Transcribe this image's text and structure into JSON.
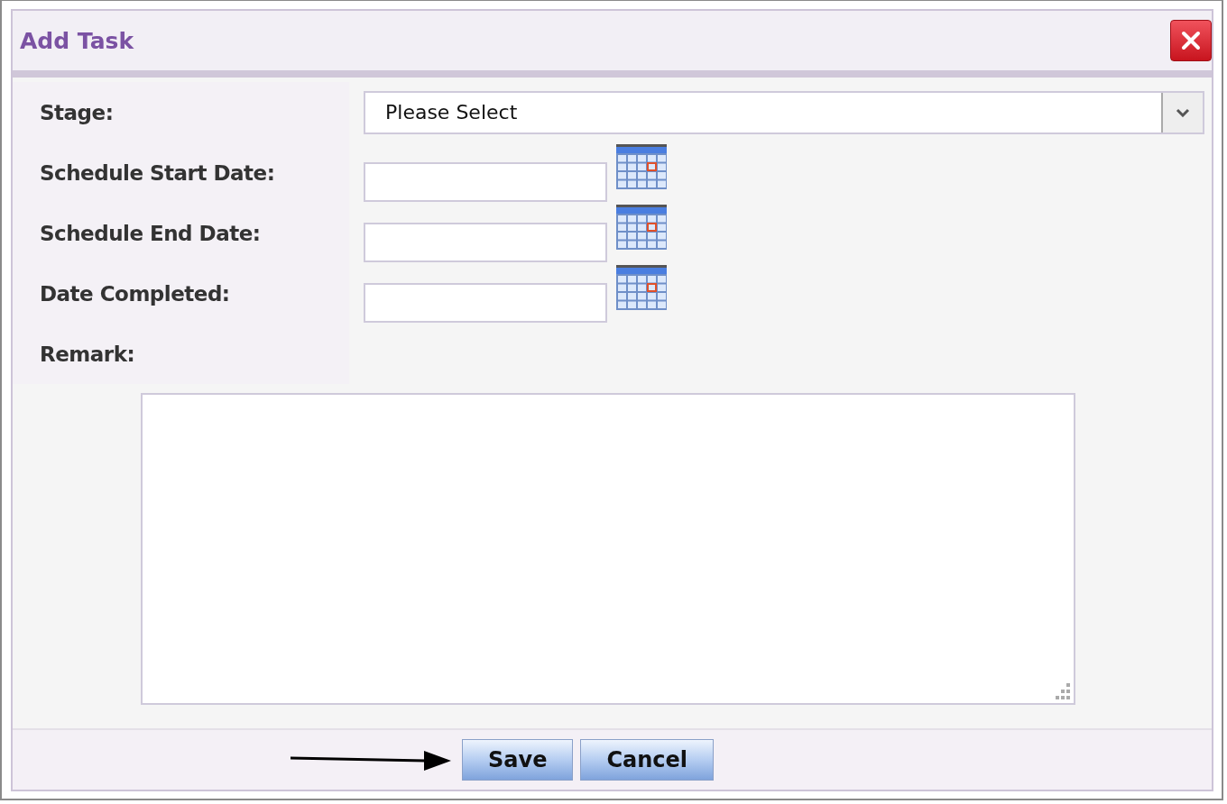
{
  "window": {
    "title": "Add Task"
  },
  "fields": [
    {
      "kind": "select",
      "label": "Stage:",
      "value": "Please Select"
    },
    {
      "kind": "date",
      "label": "Schedule Start Date:"
    },
    {
      "kind": "date",
      "label": "Schedule End Date:"
    },
    {
      "kind": "date",
      "label": "Date Completed:"
    },
    {
      "kind": "textarea",
      "label": "Remark:"
    }
  ],
  "buttons": [
    "Save",
    "Cancel"
  ]
}
